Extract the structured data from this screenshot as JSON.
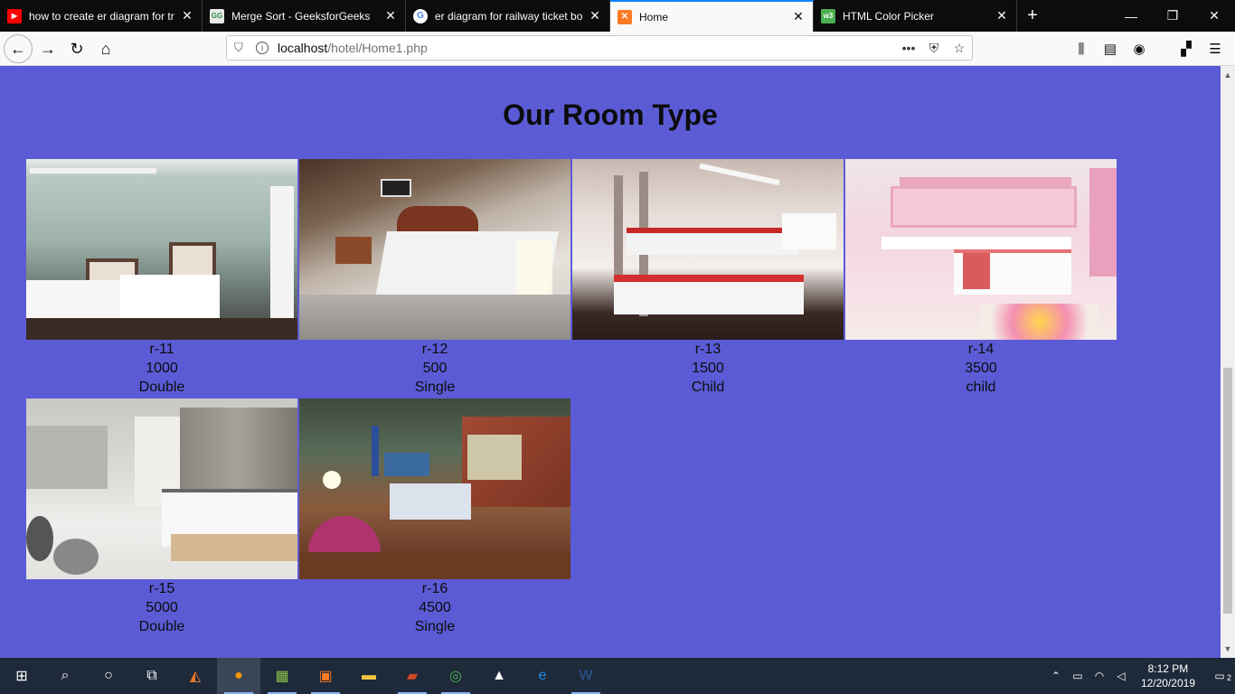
{
  "browser": {
    "tabs": [
      {
        "title": "how to create er diagram for tra",
        "icon": "youtube-icon",
        "active": false
      },
      {
        "title": "Merge Sort - GeeksforGeeks",
        "icon": "geeksforgeeks-icon",
        "active": false
      },
      {
        "title": "er diagram for railway ticket bo",
        "icon": "google-icon",
        "active": false
      },
      {
        "title": "Home",
        "icon": "xampp-icon",
        "active": true
      },
      {
        "title": "HTML Color Picker",
        "icon": "w3schools-icon",
        "active": false
      }
    ],
    "url_host": "localhost",
    "url_path": "/hotel/Home1.php"
  },
  "page": {
    "heading": "Our Room Type",
    "background": "#5b5bd6",
    "rooms": [
      {
        "id": "r-11",
        "price": "1000",
        "type": "Double"
      },
      {
        "id": "r-12",
        "price": "500",
        "type": "Single"
      },
      {
        "id": "r-13",
        "price": "1500",
        "type": "Child"
      },
      {
        "id": "r-14",
        "price": "3500",
        "type": "child"
      },
      {
        "id": "r-15",
        "price": "5000",
        "type": "Double"
      },
      {
        "id": "r-16",
        "price": "4500",
        "type": "Single"
      }
    ]
  },
  "taskbar": {
    "time": "8:12 PM",
    "date": "12/20/2019",
    "notifications": "2"
  }
}
